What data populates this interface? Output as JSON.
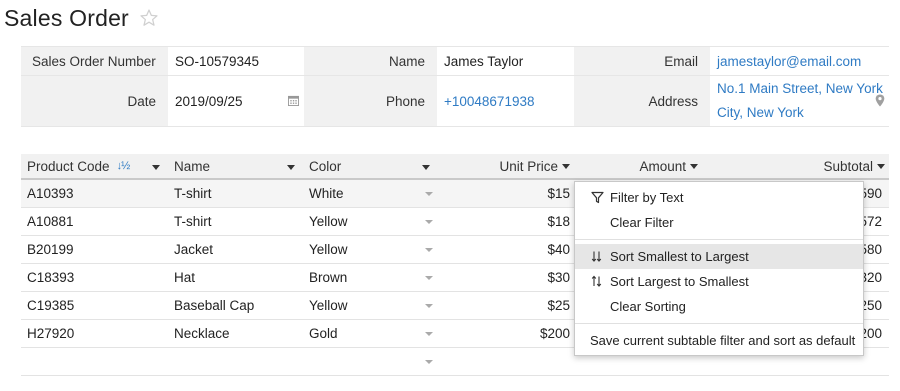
{
  "page": {
    "title": "Sales Order"
  },
  "form": {
    "order_number": {
      "label": "Sales Order Number",
      "value": "SO-10579345"
    },
    "name": {
      "label": "Name",
      "value": "James Taylor"
    },
    "email": {
      "label": "Email",
      "value": "jamestaylor@email.com"
    },
    "date": {
      "label": "Date",
      "value": "2019/09/25"
    },
    "phone": {
      "label": "Phone",
      "value": "+10048671938"
    },
    "address": {
      "label": "Address",
      "line1": "No.1 Main Street, New York",
      "line2": "City, New York"
    }
  },
  "table": {
    "columns": [
      "Product Code",
      "Name",
      "Color",
      "Unit Price",
      "Amount",
      "Subtotal"
    ],
    "rows": [
      {
        "code": "A10393",
        "name": "T-shirt",
        "color": "White",
        "price": "$15",
        "subtotal": "590"
      },
      {
        "code": "A10881",
        "name": "T-shirt",
        "color": "Yellow",
        "price": "$18",
        "subtotal": "572"
      },
      {
        "code": "B20199",
        "name": "Jacket",
        "color": "Yellow",
        "price": "$40",
        "subtotal": "580"
      },
      {
        "code": "C18393",
        "name": "Hat",
        "color": "Brown",
        "price": "$30",
        "subtotal": "320"
      },
      {
        "code": "C19385",
        "name": "Baseball Cap",
        "color": "Yellow",
        "price": "$25",
        "subtotal": "250"
      },
      {
        "code": "H27920",
        "name": "Necklace",
        "color": "Gold",
        "price": "$200",
        "subtotal": "200"
      }
    ]
  },
  "menu": {
    "filter_by_text": "Filter by Text",
    "clear_filter": "Clear Filter",
    "sort_asc": "Sort Smallest to Largest",
    "sort_desc": "Sort Largest to Smallest",
    "clear_sorting": "Clear Sorting",
    "save_default": "Save current subtable filter and sort as default"
  },
  "icons": {
    "star": "star-outline-icon",
    "calendar": "calendar-icon",
    "location": "location-pin-icon",
    "filter": "filter-icon",
    "sort_asc": "sort-ascending-icon",
    "sort_desc": "sort-descending-icon"
  },
  "colors": {
    "link": "#2f7bc4",
    "header_bg": "#f1f1f1",
    "highlight": "#e6e6e6"
  }
}
